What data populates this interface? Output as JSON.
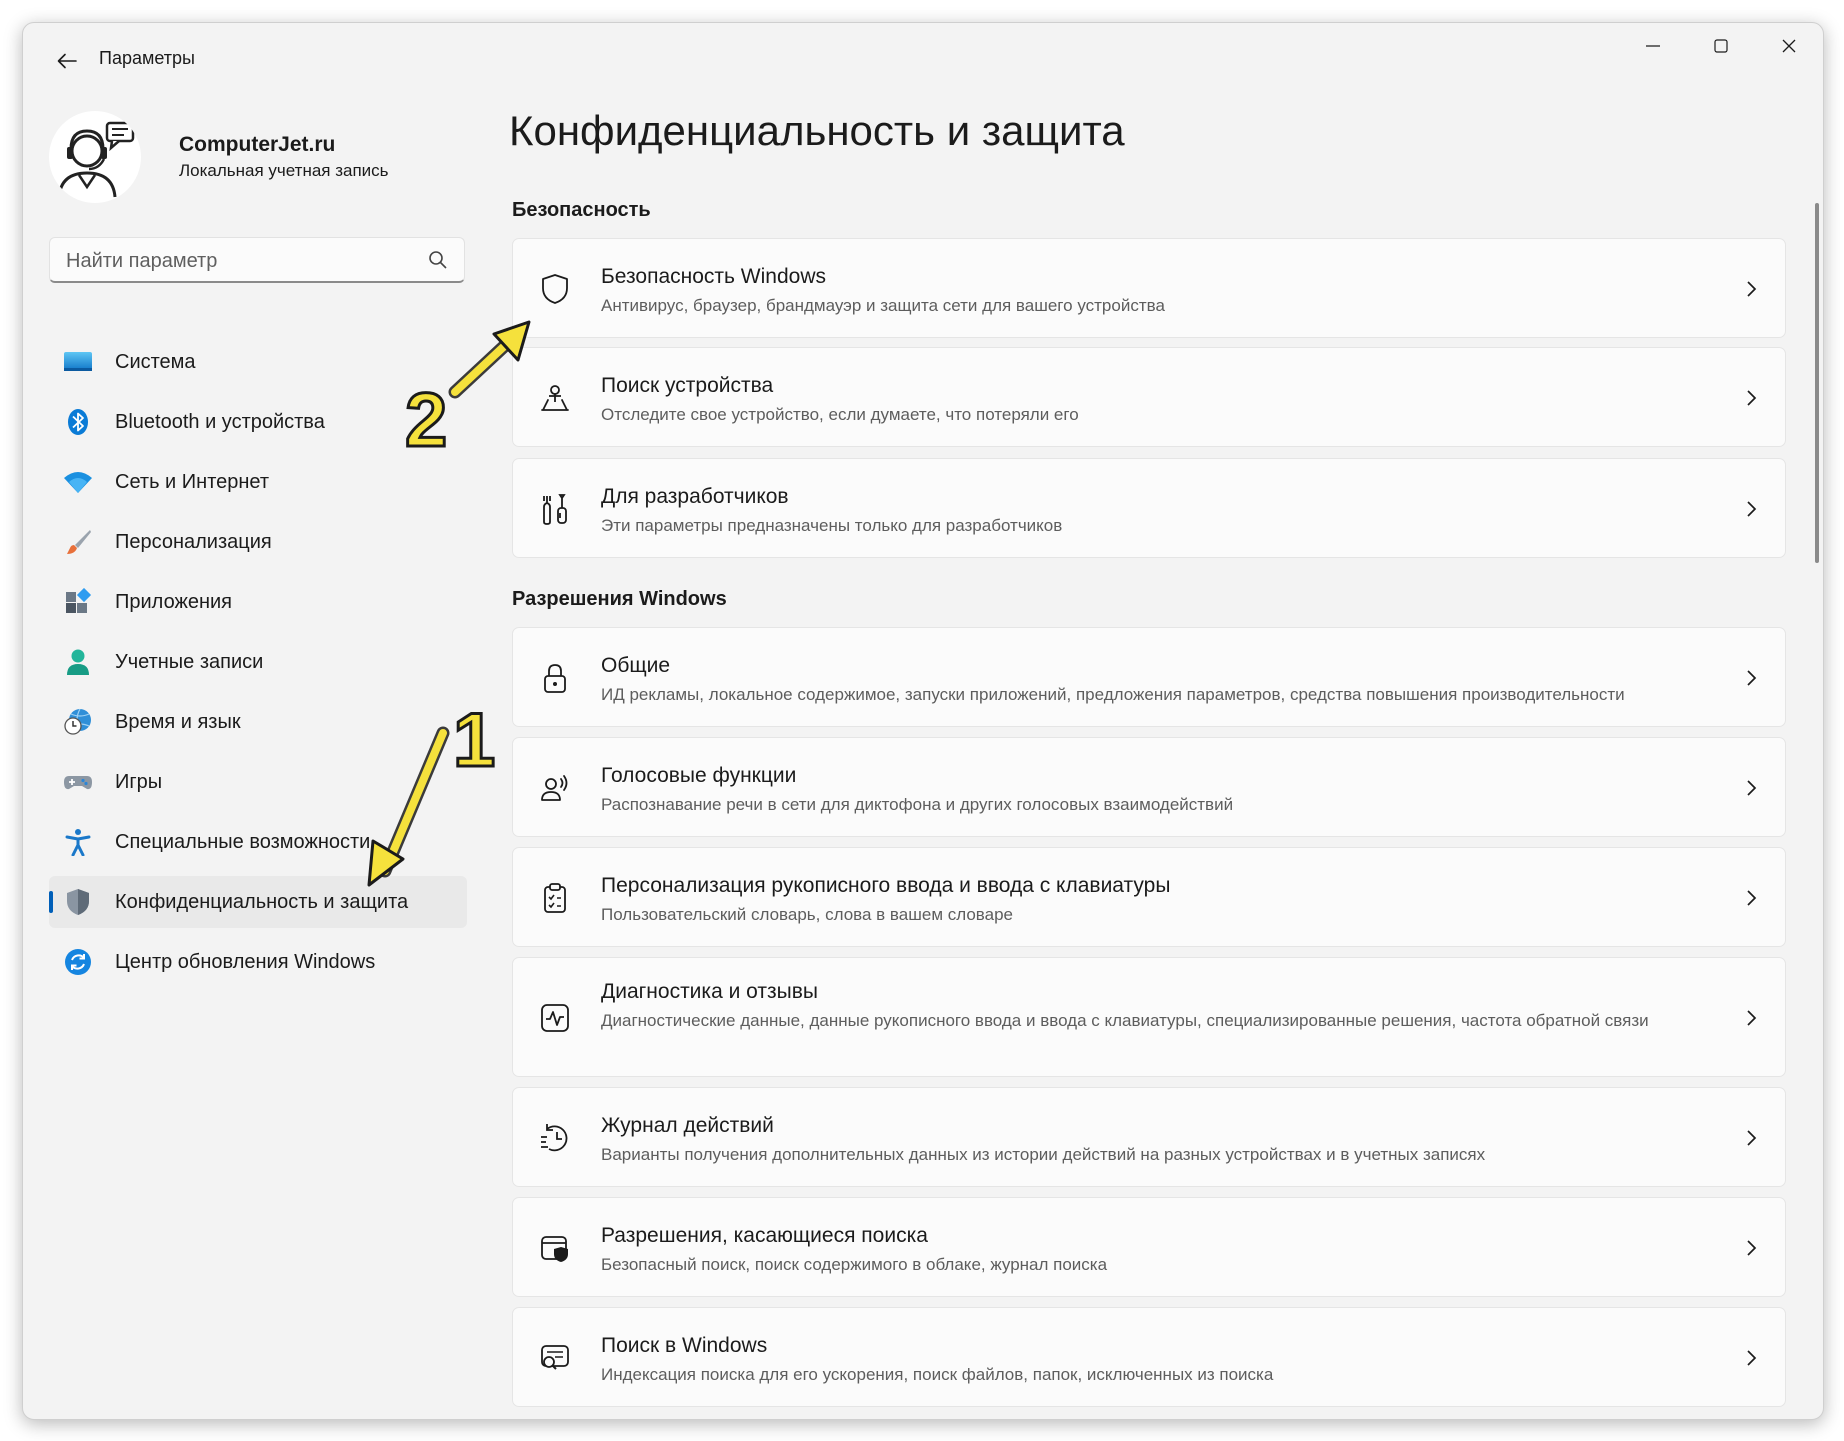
{
  "window": {
    "title": "Параметры"
  },
  "profile": {
    "name": "ComputerJet.ru",
    "account_type": "Локальная учетная запись"
  },
  "search": {
    "placeholder": "Найти параметр"
  },
  "sidebar": {
    "items": [
      {
        "label": "Система",
        "icon": "monitor-icon"
      },
      {
        "label": "Bluetooth и устройства",
        "icon": "bluetooth-icon"
      },
      {
        "label": "Сеть и Интернет",
        "icon": "wifi-icon"
      },
      {
        "label": "Персонализация",
        "icon": "brush-icon"
      },
      {
        "label": "Приложения",
        "icon": "apps-icon"
      },
      {
        "label": "Учетные записи",
        "icon": "person-icon"
      },
      {
        "label": "Время и язык",
        "icon": "clock-globe-icon"
      },
      {
        "label": "Игры",
        "icon": "gamepad-icon"
      },
      {
        "label": "Специальные возможности",
        "icon": "accessibility-icon"
      },
      {
        "label": "Конфиденциальность и защита",
        "icon": "shield-icon",
        "active": true
      },
      {
        "label": "Центр обновления Windows",
        "icon": "update-icon"
      }
    ]
  },
  "main": {
    "title": "Конфиденциальность и защита",
    "sections": [
      {
        "title": "Безопасность",
        "cards": [
          {
            "title": "Безопасность Windows",
            "desc": "Антивирус, браузер, брандмауэр и защита сети для вашего устройства",
            "icon": "shield-outline-icon"
          },
          {
            "title": "Поиск устройства",
            "desc": "Отследите свое устройство, если думаете, что потеряли его",
            "icon": "person-pin-icon"
          },
          {
            "title": "Для разработчиков",
            "desc": "Эти параметры предназначены только для разработчиков",
            "icon": "tools-icon"
          }
        ]
      },
      {
        "title": "Разрешения Windows",
        "cards": [
          {
            "title": "Общие",
            "desc": "ИД рекламы, локальное содержимое, запуски приложений, предложения параметров, средства повышения производительности",
            "icon": "lock-icon"
          },
          {
            "title": "Голосовые функции",
            "desc": "Распознавание речи в сети для диктофона и других голосовых взаимодействий",
            "icon": "speech-icon"
          },
          {
            "title": "Персонализация рукописного ввода и ввода с клавиатуры",
            "desc": "Пользовательский словарь, слова в вашем словаре",
            "icon": "clipboard-checklist-icon"
          },
          {
            "title": "Диагностика и отзывы",
            "desc": "Диагностические данные, данные рукописного ввода и ввода с клавиатуры, специализированные решения, частота обратной связи",
            "icon": "pulse-icon"
          },
          {
            "title": "Журнал действий",
            "desc": "Варианты получения дополнительных данных из истории действий на разных устройствах и в учетных записях",
            "icon": "history-icon"
          },
          {
            "title": "Разрешения, касающиеся поиска",
            "desc": "Безопасный поиск, поиск содержимого в облаке, журнал поиска",
            "icon": "search-shield-icon"
          },
          {
            "title": "Поиск в Windows",
            "desc": "Индексация поиска для его ускорения, поиск файлов, папок, исключенных из поиска",
            "icon": "search-window-icon"
          }
        ]
      }
    ]
  },
  "annotations": {
    "marker_1": "1",
    "marker_2": "2",
    "color": "#f5e13c"
  }
}
